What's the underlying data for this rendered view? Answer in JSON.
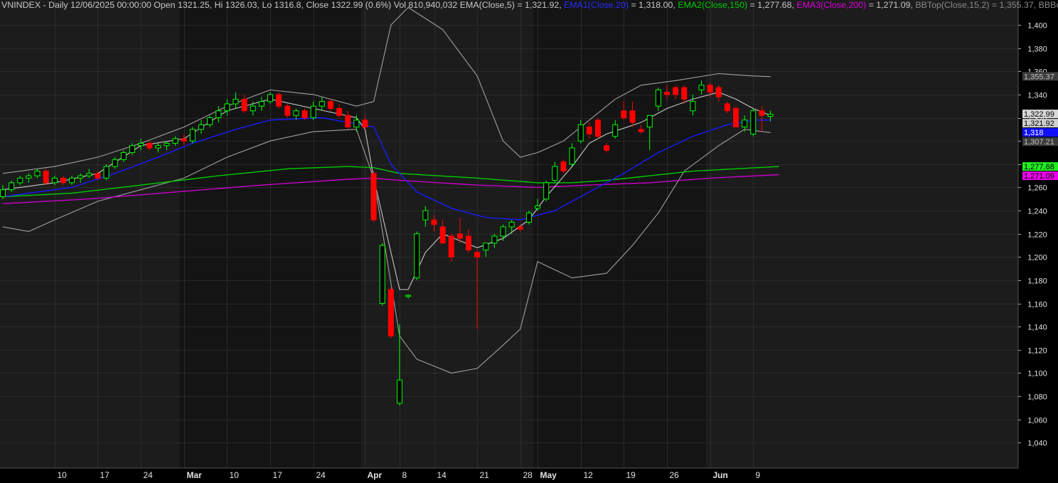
{
  "header": {
    "main": "VNINDEX - Daily 12/06/2025 00:00:00 Open 1321.25, Hi 1326.03, Lo 1316.8, Close 1322.99 (0.6%) Vol 810,940,032",
    "ema": "EMA(Close,5) = 1,321.92,",
    "ema1_name": "EMA1(Close,20)",
    "ema1_value": " = 1,318.00,",
    "ema2_name": "EMA2(Close,150)",
    "ema2_value": " = 1,277.68,",
    "ema3_name": "EMA3(Close,200)",
    "ema3_value": " = 1,271.09,",
    "bbtop": "BBTop(Close,15,2) = 1,355.37,",
    "bbbot": "BBBot(Close"
  },
  "colors": {
    "background": "#000000",
    "band_light": "#1c1c1c",
    "band_dark": "#141414",
    "grid": "#3a3a3a",
    "up": "#00ff00",
    "down": "#ff0000",
    "ema5": "#c8c8c8",
    "ema20": "#1a1aff",
    "ema150": "#00cc00",
    "ema200": "#cc00cc",
    "bb": "#a0a0a0",
    "axis_text": "#e0e0e0"
  },
  "chart_data": {
    "type": "candlestick",
    "symbol": "VNINDEX",
    "timeframe": "Daily",
    "ylim": [
      1030,
      1410
    ],
    "y_ticks": [
      1040,
      1060,
      1080,
      1100,
      1120,
      1140,
      1160,
      1180,
      1200,
      1220,
      1240,
      1260,
      1280,
      1300,
      1320,
      1340,
      1360,
      1380,
      1400
    ],
    "y_tick_labels": [
      "1,040",
      "1,060",
      "1,080",
      "1,100",
      "1,120",
      "1,140",
      "1,160",
      "1,180",
      "1,200",
      "1,220",
      "1,240",
      "1,260",
      "1,280",
      "1,300",
      "1,320",
      "1,340",
      "1,360",
      "1,380",
      "1,400"
    ],
    "x_ticks": [
      {
        "label": "10",
        "bar": 6,
        "month": false
      },
      {
        "label": "17",
        "bar": 11,
        "month": false
      },
      {
        "label": "24",
        "bar": 16,
        "month": false
      },
      {
        "label": "Mar",
        "bar": 21,
        "month": true
      },
      {
        "label": "10",
        "bar": 26,
        "month": false
      },
      {
        "label": "17",
        "bar": 31,
        "month": false
      },
      {
        "label": "24",
        "bar": 36,
        "month": false
      },
      {
        "label": "Apr",
        "bar": 42,
        "month": true
      },
      {
        "label": "8",
        "bar": 46,
        "month": false
      },
      {
        "label": "14",
        "bar": 50,
        "month": false
      },
      {
        "label": "21",
        "bar": 55,
        "month": false
      },
      {
        "label": "28",
        "bar": 60,
        "month": false
      },
      {
        "label": "May",
        "bar": 62,
        "month": true
      },
      {
        "label": "12",
        "bar": 67,
        "month": false
      },
      {
        "label": "19",
        "bar": 72,
        "month": false
      },
      {
        "label": "26",
        "bar": 77,
        "month": false
      },
      {
        "label": "Jun",
        "bar": 82,
        "month": true
      },
      {
        "label": "9",
        "bar": 87,
        "month": false
      }
    ],
    "candles": [
      [
        1252,
        1262,
        1250,
        1258
      ],
      [
        1258,
        1266,
        1256,
        1264
      ],
      [
        1264,
        1270,
        1262,
        1268
      ],
      [
        1268,
        1272,
        1264,
        1270
      ],
      [
        1270,
        1276,
        1268,
        1274
      ],
      [
        1274,
        1276,
        1262,
        1264
      ],
      [
        1264,
        1270,
        1262,
        1268
      ],
      [
        1268,
        1270,
        1262,
        1264
      ],
      [
        1264,
        1270,
        1262,
        1268
      ],
      [
        1268,
        1272,
        1264,
        1270
      ],
      [
        1270,
        1276,
        1268,
        1272
      ],
      [
        1272,
        1274,
        1266,
        1268
      ],
      [
        1268,
        1280,
        1266,
        1278
      ],
      [
        1278,
        1286,
        1276,
        1284
      ],
      [
        1284,
        1292,
        1282,
        1290
      ],
      [
        1290,
        1298,
        1288,
        1296
      ],
      [
        1296,
        1302,
        1292,
        1298
      ],
      [
        1298,
        1300,
        1292,
        1294
      ],
      [
        1294,
        1298,
        1290,
        1296
      ],
      [
        1296,
        1300,
        1292,
        1298
      ],
      [
        1298,
        1304,
        1296,
        1302
      ],
      [
        1302,
        1306,
        1296,
        1300
      ],
      [
        1300,
        1312,
        1298,
        1310
      ],
      [
        1310,
        1318,
        1306,
        1314
      ],
      [
        1314,
        1322,
        1312,
        1320
      ],
      [
        1320,
        1330,
        1316,
        1326
      ],
      [
        1326,
        1336,
        1322,
        1332
      ],
      [
        1332,
        1342,
        1328,
        1336
      ],
      [
        1336,
        1340,
        1324,
        1326
      ],
      [
        1326,
        1334,
        1322,
        1330
      ],
      [
        1330,
        1338,
        1326,
        1334
      ],
      [
        1334,
        1342,
        1332,
        1340
      ],
      [
        1340,
        1342,
        1328,
        1330
      ],
      [
        1330,
        1332,
        1320,
        1322
      ],
      [
        1322,
        1328,
        1318,
        1326
      ],
      [
        1326,
        1328,
        1318,
        1320
      ],
      [
        1320,
        1334,
        1318,
        1330
      ],
      [
        1330,
        1338,
        1326,
        1334
      ],
      [
        1334,
        1336,
        1326,
        1328
      ],
      [
        1328,
        1332,
        1320,
        1322
      ],
      [
        1322,
        1326,
        1310,
        1312
      ],
      [
        1312,
        1322,
        1308,
        1318
      ],
      [
        1318,
        1322,
        1310,
        1312
      ],
      [
        1272,
        1274,
        1230,
        1232
      ],
      [
        1160,
        1212,
        1158,
        1210
      ],
      [
        1172,
        1174,
        1130,
        1132
      ],
      [
        1074,
        1142,
        1072,
        1094
      ],
      [
        1166,
        1168,
        1164,
        1167
      ],
      [
        1182,
        1222,
        1180,
        1220
      ],
      [
        1232,
        1244,
        1226,
        1240
      ],
      [
        1232,
        1236,
        1222,
        1228
      ],
      [
        1226,
        1232,
        1212,
        1212
      ],
      [
        1218,
        1220,
        1196,
        1200
      ],
      [
        1220,
        1234,
        1212,
        1216
      ],
      [
        1218,
        1224,
        1204,
        1206
      ],
      [
        1204,
        1206,
        1138,
        1200
      ],
      [
        1206,
        1212,
        1200,
        1212
      ],
      [
        1212,
        1220,
        1208,
        1218
      ],
      [
        1218,
        1228,
        1214,
        1226
      ],
      [
        1226,
        1232,
        1220,
        1230
      ],
      [
        1226,
        1228,
        1222,
        1224
      ],
      [
        1230,
        1240,
        1228,
        1238
      ],
      [
        1242,
        1250,
        1240,
        1244
      ],
      [
        1250,
        1266,
        1248,
        1264
      ],
      [
        1266,
        1282,
        1264,
        1278
      ],
      [
        1282,
        1284,
        1272,
        1274
      ],
      [
        1280,
        1298,
        1278,
        1294
      ],
      [
        1300,
        1318,
        1298,
        1314
      ],
      [
        1312,
        1316,
        1302,
        1306
      ],
      [
        1318,
        1320,
        1302,
        1304
      ],
      [
        1296,
        1298,
        1290,
        1292
      ],
      [
        1304,
        1318,
        1302,
        1314
      ],
      [
        1326,
        1334,
        1318,
        1320
      ],
      [
        1326,
        1334,
        1312,
        1316
      ],
      [
        1310,
        1314,
        1306,
        1308
      ],
      [
        1312,
        1322,
        1292,
        1322
      ],
      [
        1330,
        1346,
        1326,
        1344
      ],
      [
        1342,
        1348,
        1336,
        1340
      ],
      [
        1346,
        1348,
        1336,
        1340
      ],
      [
        1346,
        1348,
        1332,
        1336
      ],
      [
        1326,
        1340,
        1322,
        1334
      ],
      [
        1344,
        1352,
        1340,
        1348
      ],
      [
        1348,
        1350,
        1338,
        1342
      ],
      [
        1346,
        1348,
        1334,
        1338
      ],
      [
        1332,
        1334,
        1324,
        1326
      ],
      [
        1328,
        1330,
        1312,
        1312
      ],
      [
        1312,
        1322,
        1308,
        1318
      ],
      [
        1306,
        1328,
        1304,
        1326
      ],
      [
        1326,
        1330,
        1308,
        1322
      ],
      [
        1321.25,
        1326.03,
        1316.8,
        1322.99
      ]
    ],
    "overlays": {
      "ema5": [
        [
          0,
          1258
        ],
        [
          6,
          1264
        ],
        [
          11,
          1272
        ],
        [
          16,
          1296
        ],
        [
          21,
          1302
        ],
        [
          26,
          1326
        ],
        [
          31,
          1336
        ],
        [
          36,
          1328
        ],
        [
          41,
          1320
        ],
        [
          42,
          1310
        ],
        [
          43,
          1268
        ],
        [
          46,
          1172
        ],
        [
          47,
          1172
        ],
        [
          49,
          1204
        ],
        [
          51,
          1220
        ],
        [
          55,
          1208
        ],
        [
          58,
          1216
        ],
        [
          61,
          1232
        ],
        [
          63,
          1252
        ],
        [
          66,
          1278
        ],
        [
          68,
          1298
        ],
        [
          70,
          1306
        ],
        [
          74,
          1316
        ],
        [
          77,
          1328
        ],
        [
          80,
          1336
        ],
        [
          83,
          1342
        ],
        [
          85,
          1336
        ],
        [
          87,
          1328
        ],
        [
          89,
          1322
        ]
      ],
      "ema20": [
        [
          0,
          1252
        ],
        [
          8,
          1260
        ],
        [
          13,
          1272
        ],
        [
          18,
          1286
        ],
        [
          22,
          1298
        ],
        [
          27,
          1310
        ],
        [
          31,
          1318
        ],
        [
          37,
          1320
        ],
        [
          43,
          1312
        ],
        [
          45,
          1280
        ],
        [
          48,
          1256
        ],
        [
          52,
          1242
        ],
        [
          56,
          1234
        ],
        [
          60,
          1232
        ],
        [
          64,
          1240
        ],
        [
          68,
          1256
        ],
        [
          72,
          1272
        ],
        [
          76,
          1290
        ],
        [
          80,
          1304
        ],
        [
          84,
          1314
        ],
        [
          87,
          1318
        ],
        [
          89,
          1318
        ]
      ],
      "ema150": [
        [
          0,
          1252
        ],
        [
          8,
          1255
        ],
        [
          16,
          1262
        ],
        [
          25,
          1270
        ],
        [
          33,
          1276
        ],
        [
          40,
          1278
        ],
        [
          43,
          1277
        ],
        [
          46,
          1272
        ],
        [
          55,
          1268
        ],
        [
          62,
          1264
        ],
        [
          66,
          1264
        ],
        [
          70,
          1266
        ],
        [
          75,
          1270
        ],
        [
          80,
          1274
        ],
        [
          85,
          1276
        ],
        [
          90,
          1278
        ]
      ],
      "ema200": [
        [
          0,
          1246
        ],
        [
          10,
          1250
        ],
        [
          20,
          1256
        ],
        [
          30,
          1262
        ],
        [
          40,
          1267
        ],
        [
          43,
          1268
        ],
        [
          46,
          1266
        ],
        [
          55,
          1262
        ],
        [
          62,
          1260
        ],
        [
          68,
          1262
        ],
        [
          75,
          1264
        ],
        [
          82,
          1268
        ],
        [
          90,
          1271
        ]
      ],
      "bbtop": [
        [
          0,
          1272
        ],
        [
          6,
          1278
        ],
        [
          11,
          1286
        ],
        [
          16,
          1298
        ],
        [
          21,
          1312
        ],
        [
          26,
          1330
        ],
        [
          31,
          1344
        ],
        [
          36,
          1340
        ],
        [
          41,
          1330
        ],
        [
          43,
          1334
        ],
        [
          45,
          1400
        ],
        [
          47,
          1415
        ],
        [
          51,
          1396
        ],
        [
          55,
          1356
        ],
        [
          58,
          1300
        ],
        [
          60,
          1286
        ],
        [
          62,
          1290
        ],
        [
          65,
          1300
        ],
        [
          68,
          1318
        ],
        [
          71,
          1336
        ],
        [
          74,
          1348
        ],
        [
          78,
          1352
        ],
        [
          83,
          1358
        ],
        [
          87,
          1356
        ],
        [
          89,
          1355.37
        ]
      ],
      "bbbot": [
        [
          0,
          1226
        ],
        [
          3,
          1222
        ],
        [
          6,
          1232
        ],
        [
          11,
          1248
        ],
        [
          16,
          1258
        ],
        [
          21,
          1268
        ],
        [
          26,
          1286
        ],
        [
          31,
          1300
        ],
        [
          36,
          1308
        ],
        [
          41,
          1310
        ],
        [
          43,
          1268
        ],
        [
          46,
          1132
        ],
        [
          48,
          1112
        ],
        [
          52,
          1100
        ],
        [
          55,
          1104
        ],
        [
          58,
          1124
        ],
        [
          60,
          1138
        ],
        [
          62,
          1196
        ],
        [
          66,
          1182
        ],
        [
          70,
          1186
        ],
        [
          73,
          1210
        ],
        [
          76,
          1238
        ],
        [
          79,
          1274
        ],
        [
          83,
          1296
        ],
        [
          86,
          1310
        ],
        [
          89,
          1307.21
        ]
      ]
    },
    "right_labels": [
      {
        "text": "1,355.37",
        "value": 1355.37,
        "bg": "#3c3c3c",
        "fg": "#c0c0c0"
      },
      {
        "text": "1,322.99",
        "value": 1322.99,
        "bg": "#d8d8d8",
        "fg": "#000000"
      },
      {
        "text": "1,321.92",
        "value": 1321.92,
        "bg": "#cfcfcf",
        "fg": "#000000"
      },
      {
        "text": "1,318",
        "value": 1318,
        "bg": "#1010ff",
        "fg": "#ffffff"
      },
      {
        "text": "1,307.21",
        "value": 1307.21,
        "bg": "#3c3c3c",
        "fg": "#c0c0c0"
      },
      {
        "text": "1,277.68",
        "value": 1277.68,
        "bg": "#22ee22",
        "fg": "#000000"
      },
      {
        "text": "1,271.09",
        "value": 1271.09,
        "bg": "#ee00ee",
        "fg": "#000000"
      }
    ]
  }
}
